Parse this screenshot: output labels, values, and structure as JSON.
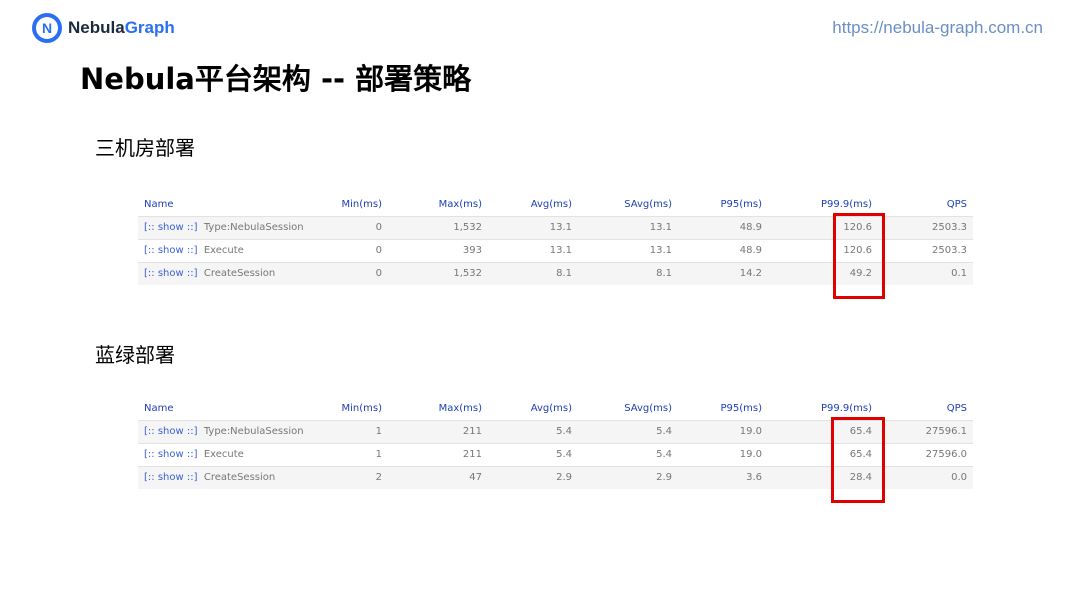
{
  "header": {
    "logo_text_primary": "Nebula",
    "logo_text_secondary": "Graph",
    "url": "https://nebula-graph.com.cn"
  },
  "title": "Nebula平台架构 -- 部署策略",
  "sections": [
    {
      "label": "三机房部署",
      "columns": [
        "Name",
        "Min(ms)",
        "Max(ms)",
        "Avg(ms)",
        "SAvg(ms)",
        "P95(ms)",
        "P99.9(ms)",
        "QPS"
      ],
      "rows": [
        {
          "link": "[:: show ::]",
          "name": "Type:NebulaSession",
          "min": "0",
          "max": "1,532",
          "avg": "13.1",
          "savg": "13.1",
          "p95": "48.9",
          "p999": "120.6",
          "qps": "2503.3"
        },
        {
          "link": "[:: show ::]",
          "name": "Execute",
          "min": "0",
          "max": "393",
          "avg": "13.1",
          "savg": "13.1",
          "p95": "48.9",
          "p999": "120.6",
          "qps": "2503.3"
        },
        {
          "link": "[:: show ::]",
          "name": "CreateSession",
          "min": "0",
          "max": "1,532",
          "avg": "8.1",
          "savg": "8.1",
          "p95": "14.2",
          "p999": "49.2",
          "qps": "0.1"
        }
      ]
    },
    {
      "label": "蓝绿部署",
      "columns": [
        "Name",
        "Min(ms)",
        "Max(ms)",
        "Avg(ms)",
        "SAvg(ms)",
        "P95(ms)",
        "P99.9(ms)",
        "QPS"
      ],
      "rows": [
        {
          "link": "[:: show ::]",
          "name": "Type:NebulaSession",
          "min": "1",
          "max": "211",
          "avg": "5.4",
          "savg": "5.4",
          "p95": "19.0",
          "p999": "65.4",
          "qps": "27596.1"
        },
        {
          "link": "[:: show ::]",
          "name": "Execute",
          "min": "1",
          "max": "211",
          "avg": "5.4",
          "savg": "5.4",
          "p95": "19.0",
          "p999": "65.4",
          "qps": "27596.0"
        },
        {
          "link": "[:: show ::]",
          "name": "CreateSession",
          "min": "2",
          "max": "47",
          "avg": "2.9",
          "savg": "2.9",
          "p95": "3.6",
          "p999": "28.4",
          "qps": "0.0"
        }
      ]
    }
  ],
  "colors": {
    "header_blue": "#1e3fb5",
    "highlight_red": "#e00000",
    "brand_blue": "#2a6ef2"
  }
}
